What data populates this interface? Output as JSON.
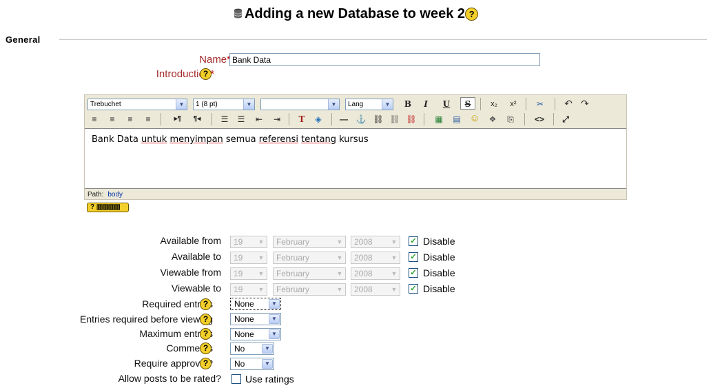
{
  "page": {
    "title": "Adding a new Database to week 2",
    "icons": {
      "title_icon": "database-icon",
      "help": "help-icon"
    }
  },
  "section": {
    "legend": "General"
  },
  "fields": {
    "name_label": "Name",
    "required_star": "*",
    "name_value": "Bank Data",
    "introduction_label": "Introduction"
  },
  "editor": {
    "font_family": "Trebuchet",
    "font_size": "1 (8 pt)",
    "format": "",
    "lang": "Lang",
    "content_parts": [
      "Bank Data ",
      "untuk",
      " ",
      "menyimpan",
      " semua ",
      "referensi",
      " ",
      "tentang",
      " kursus"
    ],
    "path_label": "Path:",
    "path_value": "body",
    "toolbar1": [
      "B",
      "I",
      "U",
      "S",
      "x₂",
      "x²",
      "✂",
      "↶",
      "↷"
    ],
    "toolbar2": [
      "≡",
      "≡",
      "≡",
      "≡",
      "▸¶",
      "¶◂",
      "☰",
      "☰",
      "⇤",
      "⇥",
      "T",
      "◈",
      "—",
      "⚓",
      "⛓",
      "⛓",
      "⛓",
      "▦",
      "▤",
      "☺",
      "❖",
      "⎘",
      "<>",
      "⤢"
    ],
    "help_badge": "?"
  },
  "dates": {
    "disable_label": "Disable",
    "rows": [
      {
        "label": "Available from",
        "day": "19",
        "month": "February",
        "year": "2008",
        "disabled": true
      },
      {
        "label": "Available to",
        "day": "19",
        "month": "February",
        "year": "2008",
        "disabled": true
      },
      {
        "label": "Viewable from",
        "day": "19",
        "month": "February",
        "year": "2008",
        "disabled": true
      },
      {
        "label": "Viewable to",
        "day": "19",
        "month": "February",
        "year": "2008",
        "disabled": true
      }
    ]
  },
  "options": {
    "required_entries": {
      "label": "Required entries",
      "value": "None"
    },
    "entries_before_viewing": {
      "label": "Entries required before viewing",
      "value": "None"
    },
    "maximum_entries": {
      "label": "Maximum entries",
      "value": "None"
    },
    "comments": {
      "label": "Comments",
      "value": "No"
    },
    "require_approval": {
      "label": "Require approval?",
      "value": "No"
    },
    "allow_rating": {
      "label": "Allow posts to be rated?",
      "checkbox_label": "Use ratings",
      "checked": false
    }
  }
}
